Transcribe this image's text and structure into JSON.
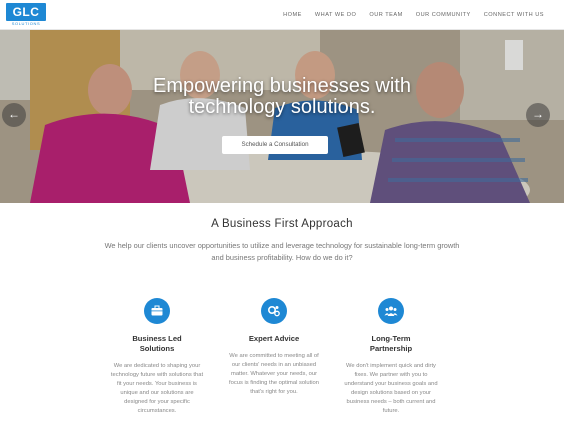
{
  "brand": {
    "logo_text": "GLC",
    "logo_sub": "SOLUTIONS",
    "accent": "#1e88d4"
  },
  "nav": {
    "items": [
      {
        "label": "HOME"
      },
      {
        "label": "WHAT WE DO"
      },
      {
        "label": "OUR TEAM"
      },
      {
        "label": "OUR COMMUNITY"
      },
      {
        "label": "CONNECT WITH US"
      }
    ]
  },
  "hero": {
    "title_line1": "Empowering businesses with",
    "title_line2": "technology solutions.",
    "cta_label": "Schedule a Consultation",
    "prev_icon": "arrow-left-icon",
    "next_icon": "arrow-right-icon"
  },
  "section": {
    "title": "A Business First Approach",
    "description": "We help our clients uncover opportunities to utilize and leverage technology for sustainable long-term growth and business profitability. How do we do it?"
  },
  "features": [
    {
      "icon": "briefcase-icon",
      "title_line1": "Business Led",
      "title_line2": "Solutions",
      "text": "We are dedicated to shaping your technology future with solutions that fit your needs. Your business is unique and our solutions are designed for your specific circumstances."
    },
    {
      "icon": "gears-icon",
      "title_line1": "Expert Advice",
      "title_line2": "",
      "text": "We are committed to meeting all of our clients' needs in an unbiased matter. Whatever your needs, our focus is finding the optimal solution that's right for you."
    },
    {
      "icon": "people-icon",
      "title_line1": "Long-Term",
      "title_line2": "Partnership",
      "text": "We don't implement quick and dirty fixes. We partner with you to understand your business goals and design solutions based on your business needs – both current and future."
    }
  ]
}
